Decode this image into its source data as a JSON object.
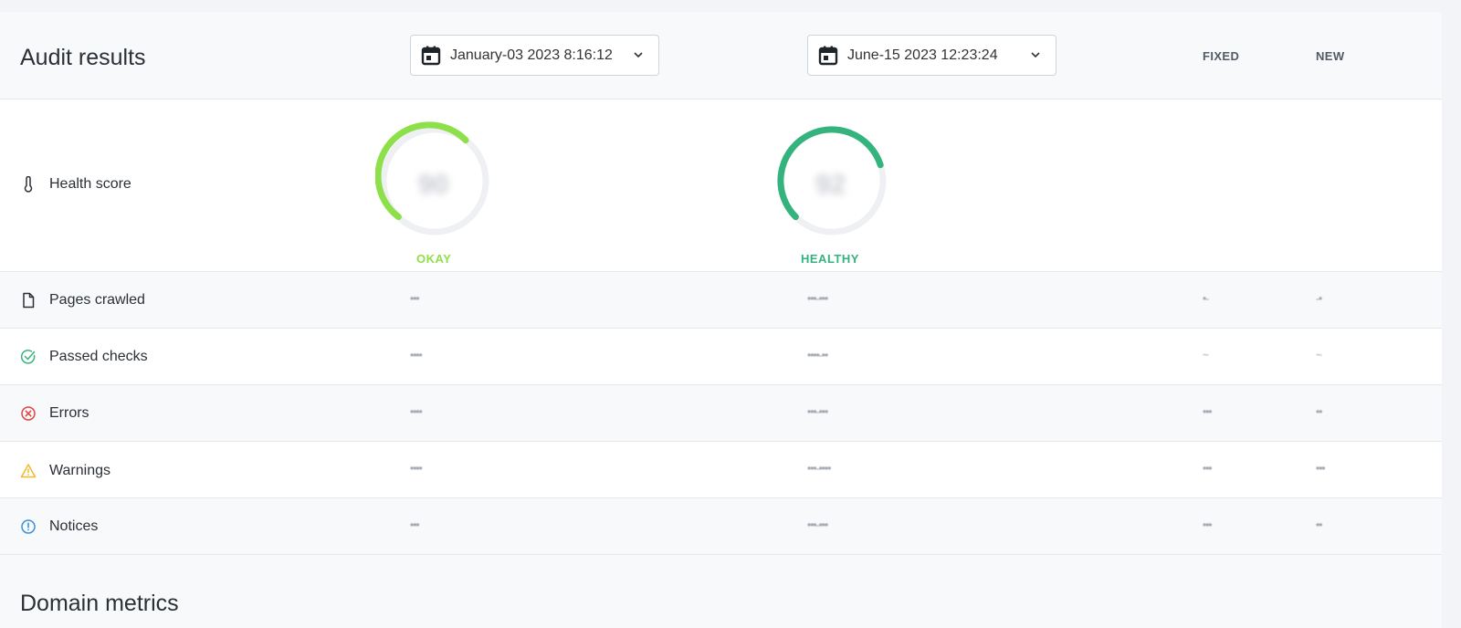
{
  "header": {
    "title": "Audit results",
    "date1": "January-03 2023 8:16:12",
    "date2": "June-15 2023 12:23:24",
    "col_fixed": "FIXED",
    "col_new": "NEW"
  },
  "health": {
    "label": "Health score",
    "gauge1": {
      "status": "OKAY",
      "value": "90",
      "color": "#8ee04a"
    },
    "gauge2": {
      "status": "HEALTHY",
      "value": "92",
      "color": "#35b37e"
    }
  },
  "rows": [
    {
      "label": "Pages crawled",
      "icon": "document-icon",
      "v1": "•••",
      "v2": "•••-•••",
      "fixed": "•-",
      "new": "-•"
    },
    {
      "label": "Passed checks",
      "icon": "check-circle-icon",
      "v1": "••••",
      "v2": "••••-••",
      "fixed": "~",
      "new": "~"
    },
    {
      "label": "Errors",
      "icon": "error-circle-icon",
      "v1": "••••",
      "v2": "•••-•••",
      "fixed": "•••",
      "new": "••"
    },
    {
      "label": "Warnings",
      "icon": "warning-triangle-icon",
      "v1": "••••",
      "v2": "•••-••••",
      "fixed": "•••",
      "new": "•••"
    },
    {
      "label": "Notices",
      "icon": "info-circle-icon",
      "v1": "•••",
      "v2": "•••-•••",
      "fixed": "•••",
      "new": "••"
    }
  ],
  "section2": {
    "title": "Domain metrics"
  },
  "colors": {
    "error": "#e04444",
    "warning": "#f2b82e",
    "info": "#3a8fd9",
    "success": "#35b37e"
  }
}
